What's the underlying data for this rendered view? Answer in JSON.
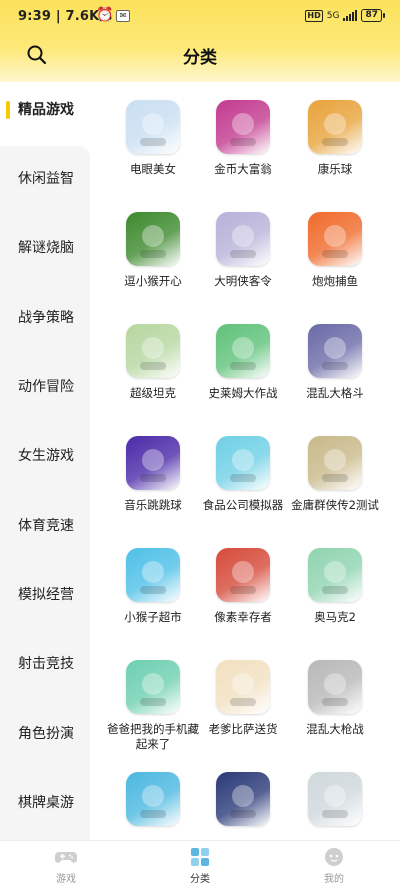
{
  "status_bar": {
    "time": "9:39",
    "speed": "| 7.6K/s",
    "network": "5G",
    "battery": "87"
  },
  "header": {
    "title": "分类",
    "search_icon": "search-icon"
  },
  "sidebar": {
    "items": [
      {
        "label": "精品游戏",
        "active": true
      },
      {
        "label": "休闲益智",
        "active": false
      },
      {
        "label": "解谜烧脑",
        "active": false
      },
      {
        "label": "战争策略",
        "active": false
      },
      {
        "label": "动作冒险",
        "active": false
      },
      {
        "label": "女生游戏",
        "active": false
      },
      {
        "label": "体育竞速",
        "active": false
      },
      {
        "label": "模拟经营",
        "active": false
      },
      {
        "label": "射击竞技",
        "active": false
      },
      {
        "label": "角色扮演",
        "active": false
      },
      {
        "label": "棋牌桌游",
        "active": false
      }
    ],
    "accent": "#f7c900"
  },
  "games": [
    {
      "name": "电眼美女",
      "color": "#c9dff2"
    },
    {
      "name": "金币大富翁",
      "color": "#c23a8f"
    },
    {
      "name": "康乐球",
      "color": "#e8a33a"
    },
    {
      "name": "逗小猴开心",
      "color": "#3d8a2e"
    },
    {
      "name": "大明侠客令",
      "color": "#b7b2d8"
    },
    {
      "name": "炮炮捕鱼",
      "color": "#f06a2a"
    },
    {
      "name": "超级坦克",
      "color": "#b6d7a0"
    },
    {
      "name": "史莱姆大作战",
      "color": "#5fc27a"
    },
    {
      "name": "混乱大格斗",
      "color": "#6a6aa8"
    },
    {
      "name": "音乐跳跳球",
      "color": "#4b2aa8"
    },
    {
      "name": "食品公司模拟器",
      "color": "#6fd0e6"
    },
    {
      "name": "金庸群侠传2测试",
      "color": "#c9b98a"
    },
    {
      "name": "小猴子超市",
      "color": "#4fc0e8"
    },
    {
      "name": "像素幸存者",
      "color": "#d64a3a"
    },
    {
      "name": "奥马克2",
      "color": "#8fd4b0"
    },
    {
      "name": "爸爸把我的手机藏起来了",
      "color": "#6ecfb0"
    },
    {
      "name": "老爹比萨送货",
      "color": "#f2e0c0"
    },
    {
      "name": "混乱大枪战",
      "color": "#b8b8b8"
    },
    {
      "name": "",
      "color": "#4cb8e0"
    },
    {
      "name": "",
      "color": "#2a3a78"
    },
    {
      "name": "",
      "color": "#cfd8dc"
    }
  ],
  "bottom_nav": [
    {
      "label": "游戏",
      "icon": "gamepad-icon",
      "active": false
    },
    {
      "label": "分类",
      "icon": "category-grid-icon",
      "active": true
    },
    {
      "label": "我的",
      "icon": "profile-icon",
      "active": false
    }
  ]
}
